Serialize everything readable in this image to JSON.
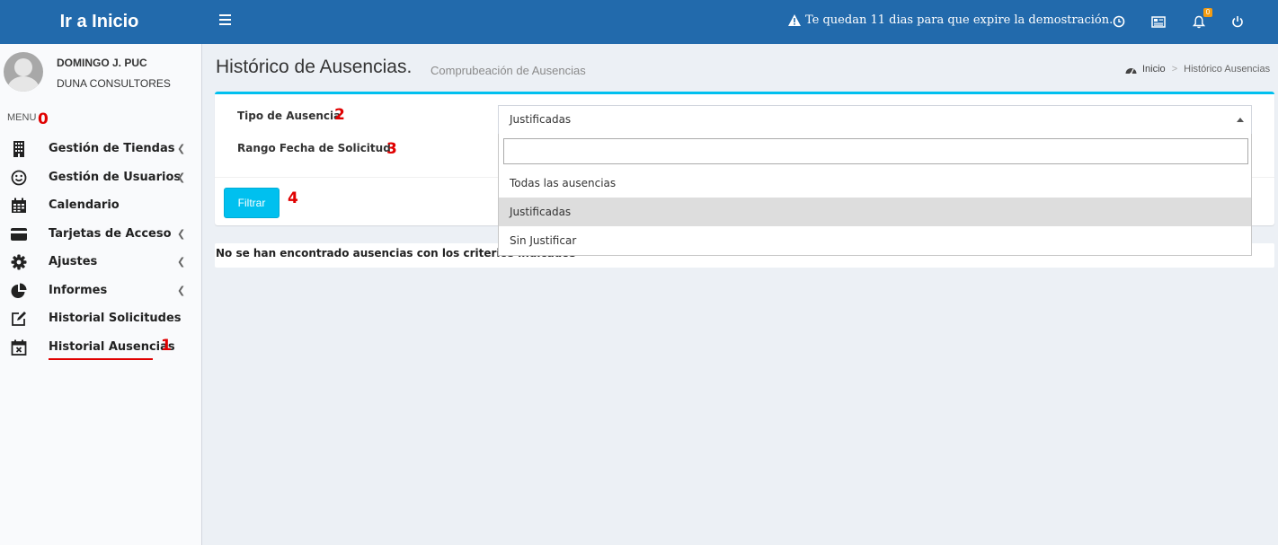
{
  "header": {
    "logo": "Ir a Inicio",
    "demo_message": "Te quedan 11 dias para que expire la demostración.",
    "notification_count": "0"
  },
  "user": {
    "name": "DOMINGO J. PUC",
    "company": "DUNA CONSULTORES"
  },
  "sidebar": {
    "menu_header": "MENU",
    "items": [
      {
        "label": "Gestión de Tiendas",
        "icon": "building-icon",
        "has_submenu": true
      },
      {
        "label": "Gestión de Usuarios",
        "icon": "smiley-icon",
        "has_submenu": true
      },
      {
        "label": "Calendario",
        "icon": "calendar-icon",
        "has_submenu": false
      },
      {
        "label": "Tarjetas de Acceso",
        "icon": "credit-card-icon",
        "has_submenu": true
      },
      {
        "label": "Ajustes",
        "icon": "gear-icon",
        "has_submenu": true
      },
      {
        "label": "Informes",
        "icon": "pie-chart-icon",
        "has_submenu": true
      },
      {
        "label": "Historial Solicitudes",
        "icon": "edit-icon",
        "has_submenu": false
      },
      {
        "label": "Historial Ausencias",
        "icon": "calendar-x-icon",
        "has_submenu": false,
        "active": true
      }
    ]
  },
  "markers": {
    "m0": "0",
    "m1": "1",
    "m2": "2",
    "m3": "3",
    "m4": "4"
  },
  "page": {
    "title": "Histórico de Ausencias.",
    "subtitle": "Comprubeación de Ausencias"
  },
  "breadcrumb": {
    "home": "Inicio",
    "current": "Histórico Ausencias"
  },
  "form": {
    "tipo_label": "Tipo de Ausencia",
    "rango_label": "Rango Fecha de Solicitud",
    "tipo_selected": "Justificadas",
    "tipo_options": [
      "Todas las ausencias",
      "Justificadas",
      "Sin Justificar"
    ],
    "filter_button": "Filtrar"
  },
  "results": {
    "message": "No se han encontrado ausencias con los criterios indicados"
  },
  "colors": {
    "topbar": "#226aac",
    "accent": "#00c0ef",
    "marker_red": "#e00000"
  }
}
